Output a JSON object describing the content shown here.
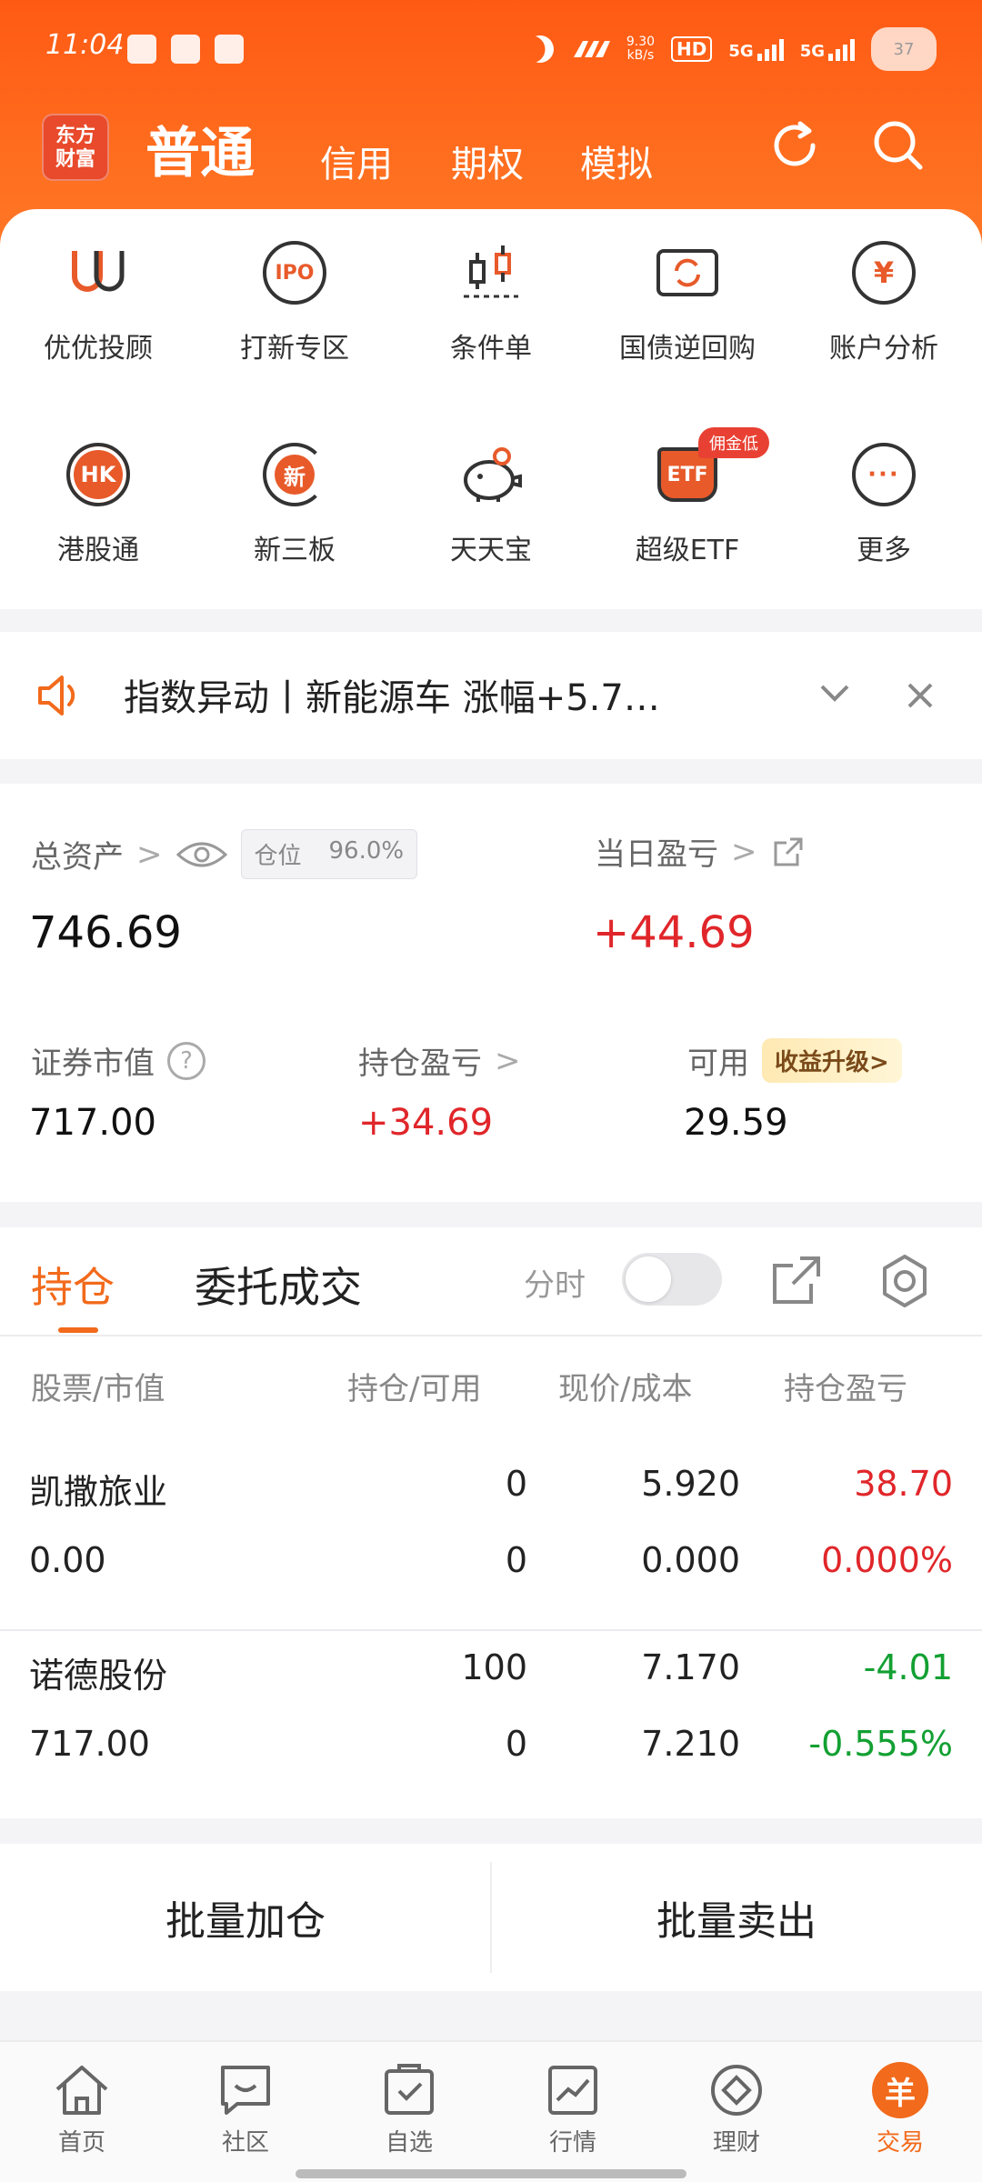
{
  "status": {
    "time": "11:04",
    "net_speed_top": "9.30",
    "net_speed_unit": "kB/s",
    "hd": "HD",
    "sig1": "5G",
    "sig2": "5G",
    "battery": "37"
  },
  "header": {
    "logo": [
      "东方",
      "财富"
    ],
    "tabs": [
      "普通",
      "信用",
      "期权",
      "模拟"
    ],
    "active_tab": "普通"
  },
  "quick": [
    {
      "label": "优优投顾",
      "icon": "uu-advisor-icon"
    },
    {
      "label": "打新专区",
      "icon": "ipo-icon",
      "icon_text": "IPO"
    },
    {
      "label": "条件单",
      "icon": "candlestick-icon"
    },
    {
      "label": "国债逆回购",
      "icon": "repo-icon"
    },
    {
      "label": "账户分析",
      "icon": "yen-chart-icon",
      "icon_text": "¥"
    },
    {
      "label": "港股通",
      "icon": "hk-icon",
      "icon_text": "HK"
    },
    {
      "label": "新三板",
      "icon": "xin-icon",
      "icon_text": "新"
    },
    {
      "label": "天天宝",
      "icon": "piggy-bank-icon"
    },
    {
      "label": "超级ETF",
      "icon": "etf-icon",
      "icon_text": "ETF",
      "badge": "佣金低"
    },
    {
      "label": "更多",
      "icon": "more-icon",
      "icon_text": "···"
    }
  ],
  "notice": {
    "text": "指数异动丨新能源车 涨幅+5.7…"
  },
  "assets": {
    "total_label": "总资产",
    "position_label": "仓位",
    "position_value": "96.0%",
    "total_value": "746.69",
    "daily_pl_label": "当日盈亏",
    "daily_pl_value": "+44.69",
    "market_value_label": "证券市值",
    "market_value": "717.00",
    "holding_pl_label": "持仓盈亏",
    "holding_pl_value": "+34.69",
    "available_label": "可用",
    "available_value": "29.59",
    "upgrade_label": "收益升级>"
  },
  "holdings": {
    "tabs": [
      "持仓",
      "委托成交"
    ],
    "intraday_label": "分时",
    "headers": [
      "股票/市值",
      "持仓/可用",
      "现价/成本",
      "持仓盈亏"
    ],
    "rows": [
      {
        "name": "凯撒旅业",
        "market_value": "0.00",
        "hold": "0",
        "avail": "0",
        "price": "5.920",
        "cost": "0.000",
        "pl": "38.70",
        "pl_pct": "0.000%",
        "trend": "up"
      },
      {
        "name": "诺德股份",
        "market_value": "717.00",
        "hold": "100",
        "avail": "0",
        "price": "7.170",
        "cost": "7.210",
        "pl": "-4.01",
        "pl_pct": "-0.555%",
        "trend": "down"
      }
    ]
  },
  "batch": {
    "add": "批量加仓",
    "sell": "批量卖出"
  },
  "bottom_nav": [
    {
      "label": "首页",
      "icon": "home-icon"
    },
    {
      "label": "社区",
      "icon": "community-icon"
    },
    {
      "label": "自选",
      "icon": "watchlist-icon"
    },
    {
      "label": "行情",
      "icon": "market-icon"
    },
    {
      "label": "理财",
      "icon": "wealth-icon"
    },
    {
      "label": "交易",
      "icon": "trade-icon",
      "active": true
    }
  ],
  "colors": {
    "brand": "#ff5a14",
    "accent": "#f26a1b",
    "up": "#e0262a",
    "down": "#12a032"
  }
}
